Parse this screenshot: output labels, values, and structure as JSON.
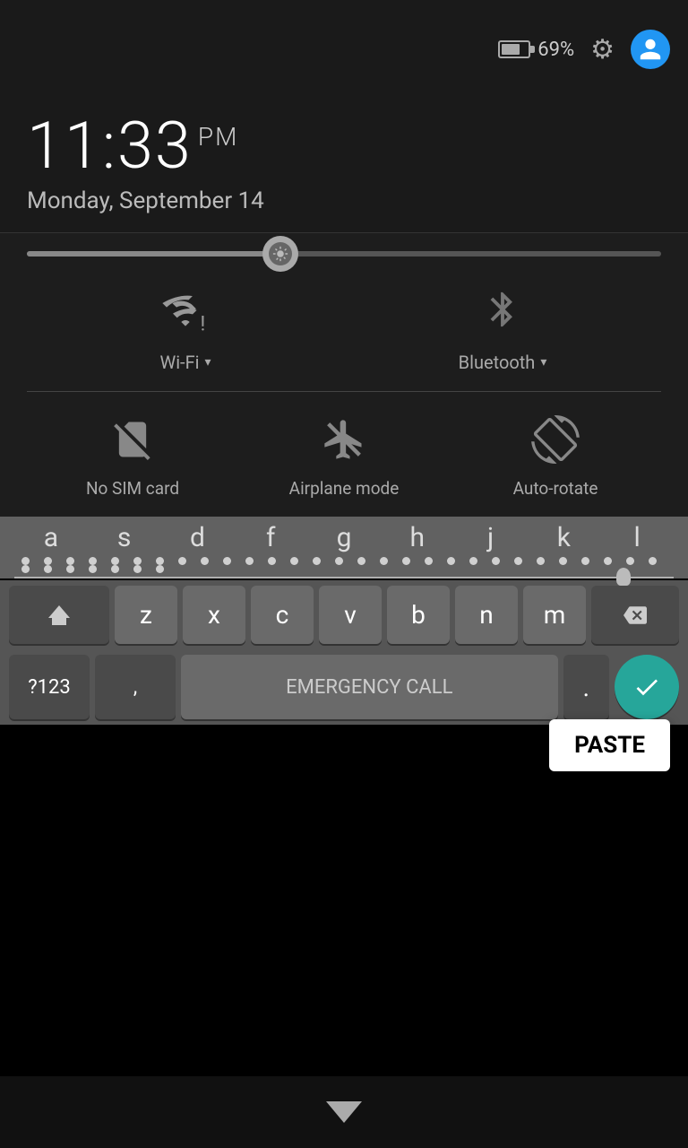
{
  "statusBar": {
    "batteryPct": "69%",
    "settingsIcon": "⚙",
    "avatarIcon": "person"
  },
  "timeArea": {
    "time": "11:33",
    "ampm": "PM",
    "date": "Monday, September 14"
  },
  "quickSettings": {
    "brightnessLabel": "Brightness",
    "toggles": [
      {
        "id": "wifi",
        "label": "Wi-Fi",
        "hasDropdown": true
      },
      {
        "id": "bluetooth",
        "label": "Bluetooth",
        "hasDropdown": true
      }
    ],
    "toggles2": [
      {
        "id": "nosim",
        "label": "No SIM card"
      },
      {
        "id": "airplane",
        "label": "Airplane mode"
      },
      {
        "id": "autorotate",
        "label": "Auto-rotate"
      }
    ]
  },
  "pastePopup": {
    "label": "PASTE"
  },
  "keyboard": {
    "row1": [
      "a",
      "s",
      "d",
      "f",
      "g",
      "h",
      "j",
      "k",
      "l"
    ],
    "row2": [
      "z",
      "x",
      "c",
      "v",
      "b",
      "n",
      "m"
    ],
    "symLabel": "?123",
    "commaLabel": ",",
    "emergencyCall": "EMERGENCY CALL",
    "periodLabel": ".",
    "enterIcon": "✓"
  },
  "navBar": {
    "backIcon": "▽"
  }
}
